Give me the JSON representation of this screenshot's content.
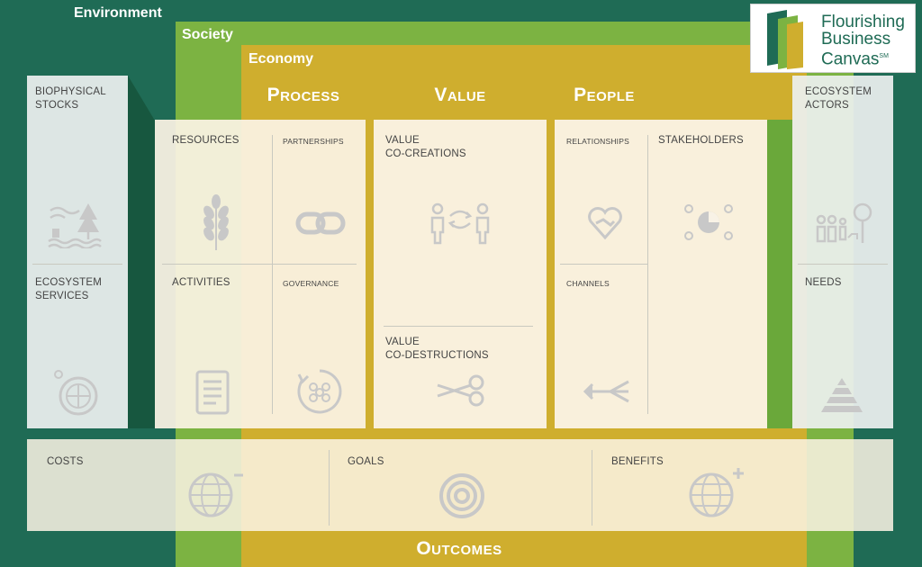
{
  "bands": {
    "environment": "Environment",
    "society": "Society",
    "economy": "Economy"
  },
  "logo": {
    "line1": "Flourishing",
    "line2": "Business",
    "line3": "Canvas",
    "sup": "SM"
  },
  "headers": {
    "process": "Process",
    "value": "Value",
    "people": "People",
    "outcomes": "Outcomes"
  },
  "cells": {
    "biophysical_stocks": "BIOPHYSICAL\nSTOCKS",
    "ecosystem_services": "ECOSYSTEM\nSERVICES",
    "resources": "RESOURCES",
    "partnerships": "PARTNERSHIPS",
    "activities": "ACTIVITIES",
    "governance": "GOVERNANCE",
    "value_co_creations": "VALUE\nCO-CREATIONS",
    "value_co_destructions": "VALUE\nCO-DESTRUCTIONS",
    "relationships": "RELATIONSHIPS",
    "stakeholders": "STAKEHOLDERS",
    "channels": "CHANNELS",
    "ecosystem_actors": "ECOSYSTEM\nACTORS",
    "needs": "NEEDS",
    "costs": "COSTS",
    "goals": "GOALS",
    "benefits": "BENEFITS"
  },
  "icons": {
    "biophysical_stocks": "landscape-tree-icon",
    "ecosystem_services": "globe-cycle-icon",
    "resources": "wheat-icon",
    "partnerships": "chain-link-icon",
    "activities": "checklist-icon",
    "governance": "group-cycle-icon",
    "value_co_creations": "people-exchange-icon",
    "value_co_destructions": "scissors-icon",
    "relationships": "heart-handshake-icon",
    "stakeholders": "pie-people-icon",
    "channels": "arrows-icon",
    "ecosystem_actors": "family-tree-icon",
    "needs": "pyramid-icon",
    "costs": "globe-minus-icon",
    "goals": "target-icon",
    "benefits": "globe-plus-icon"
  },
  "colors": {
    "environment": "#1f6b55",
    "society": "#7cb342",
    "economy": "#cfae2e",
    "cell_bg": "#fbf3e4",
    "side_bg": "#e9eeec"
  }
}
